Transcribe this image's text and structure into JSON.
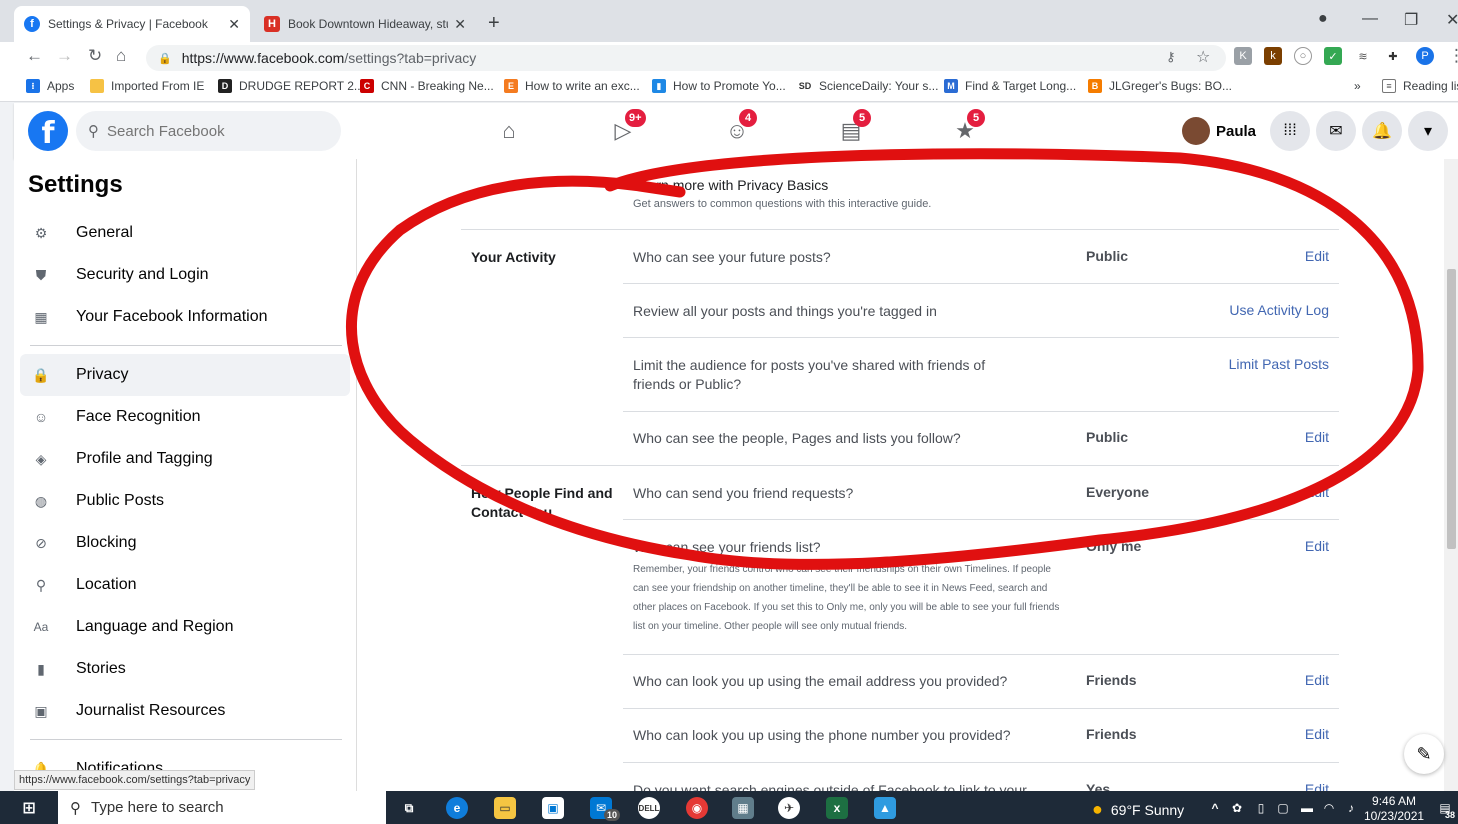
{
  "browser": {
    "tabs": [
      {
        "title": "Settings & Privacy | Facebook",
        "active": true
      },
      {
        "title": "Book Downtown Hideaway, stud",
        "active": false
      }
    ],
    "url_host": "https://www.facebook.com",
    "url_path": "/settings?tab=privacy",
    "bookmarks": [
      {
        "label": "Apps",
        "color": "#1a73e8"
      },
      {
        "label": "Imported From IE",
        "color": "#f6c244"
      },
      {
        "label": "DRUDGE REPORT 2...",
        "color": "#222222"
      },
      {
        "label": "CNN - Breaking Ne...",
        "color": "#cc0000"
      },
      {
        "label": "How to write an exc...",
        "color": "#f47b20"
      },
      {
        "label": "How to Promote Yo...",
        "color": "#1e88e5"
      },
      {
        "label": "ScienceDaily: Your s...",
        "color": "#333333"
      },
      {
        "label": "Find & Target Long...",
        "color": "#2b6cd4"
      },
      {
        "label": "JLGreger's Bugs: BO...",
        "color": "#f57c00"
      }
    ],
    "reading_list": "Reading lis",
    "status_url": "https://www.facebook.com/settings?tab=privacy"
  },
  "facebook": {
    "search_placeholder": "Search Facebook",
    "badges": {
      "watch": "9+",
      "groups": "4",
      "pages": "5",
      "gaming": "5"
    },
    "profile_name": "Paula"
  },
  "sidebar": {
    "title": "Settings",
    "items": [
      {
        "label": "General",
        "icon": "gear-icon"
      },
      {
        "label": "Security and Login",
        "icon": "shield-icon"
      },
      {
        "label": "Your Facebook Information",
        "icon": "grid-icon"
      },
      {
        "label": "Privacy",
        "icon": "lock-icon"
      },
      {
        "label": "Face Recognition",
        "icon": "face-icon"
      },
      {
        "label": "Profile and Tagging",
        "icon": "tag-icon"
      },
      {
        "label": "Public Posts",
        "icon": "globe-icon"
      },
      {
        "label": "Blocking",
        "icon": "block-user-icon"
      },
      {
        "label": "Location",
        "icon": "location-pin-icon"
      },
      {
        "label": "Language and Region",
        "icon": "language-icon"
      },
      {
        "label": "Stories",
        "icon": "book-icon"
      },
      {
        "label": "Journalist Resources",
        "icon": "id-card-icon"
      },
      {
        "label": "Notifications",
        "icon": "bell-icon"
      }
    ]
  },
  "privacy": {
    "basics_title": "Learn more with Privacy Basics",
    "basics_sub": "Get answers to common questions with this interactive guide.",
    "your_activity": "Your Activity",
    "q_future_posts": "Who can see your future posts?",
    "v_future_posts": "Public",
    "q_review": "Review all your posts and things you're tagged in",
    "a_review": "Use Activity Log",
    "q_limit_1": "Limit the audience for posts you've shared with friends of",
    "q_limit_2": "friends or Public?",
    "a_limit": "Limit Past Posts",
    "q_follow": "Who can see the people, Pages and lists you follow?",
    "v_follow": "Public",
    "how_people_1": "How People Find and",
    "how_people_2": "Contact You",
    "q_friend_req": "Who can send you friend requests?",
    "v_friend_req": "Everyone",
    "q_friends_list": "Who can see your friends list?",
    "v_friends_list": "Only me",
    "friends_note_1": "Remember, your friends control who can see their friendships on their own Timelines. If people",
    "friends_note_2": "can see your friendship on another timeline, they'll be able to see it in News Feed, search and",
    "friends_note_3": "other places on Facebook. If you set this to Only me, only you will be able to see your full friends",
    "friends_note_4": "list on your timeline. Other people will see only mutual friends.",
    "q_email": "Who can look you up using the email address you provided?",
    "v_email": "Friends",
    "q_phone": "Who can look you up using the phone number you provided?",
    "v_phone": "Friends",
    "q_search": "Do you want search engines outside of Facebook to link to your",
    "v_search": "Yes",
    "edit": "Edit"
  },
  "taskbar": {
    "search_placeholder": "Type here to search",
    "weather": "69°F  Sunny",
    "time": "9:46 AM",
    "date": "10/23/2021",
    "mail_badge": "10",
    "notif_count": "38"
  },
  "colors": {
    "facebook_blue": "#1877f2",
    "link": "#4267b2",
    "badge_red": "#e41e3f",
    "scribble_red": "#e01010"
  }
}
